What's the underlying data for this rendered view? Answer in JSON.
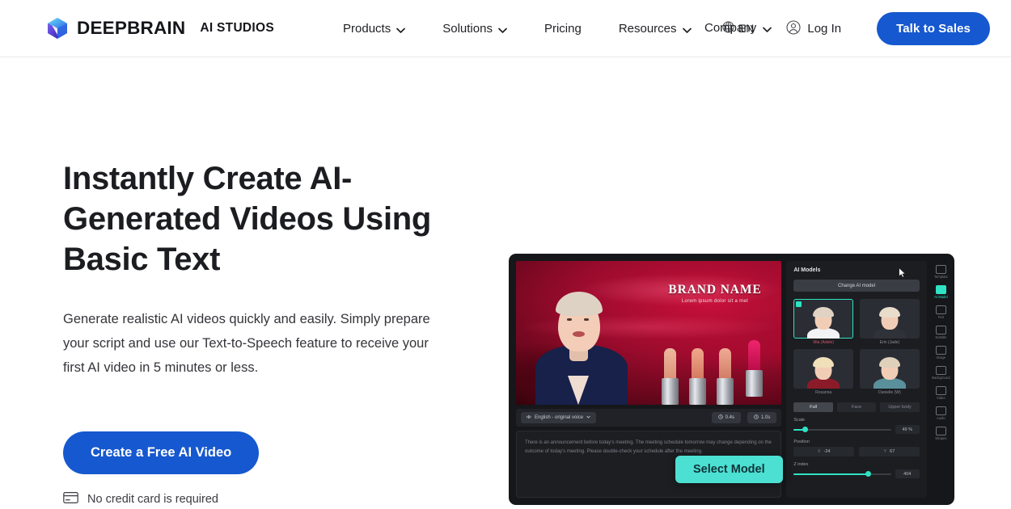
{
  "header": {
    "logo_icon": "deepbrain-cube-logo",
    "brand_name": "DEEPBRAIN",
    "brand_sub": "AI STUDIOS",
    "nav_items": [
      {
        "label": "Products",
        "has_caret": true,
        "icon": "chevron-down-icon"
      },
      {
        "label": "Solutions",
        "has_caret": true,
        "icon": "chevron-down-icon"
      },
      {
        "label": "Pricing",
        "has_caret": false,
        "icon": ""
      },
      {
        "label": "Resources",
        "has_caret": true,
        "icon": "chevron-down-icon"
      },
      {
        "label": "Company",
        "has_caret": true,
        "icon": "chevron-down-icon"
      }
    ],
    "language": {
      "label": "EN",
      "icon": "globe-icon"
    },
    "login": {
      "label": "Log In",
      "icon": "user-circle-icon"
    },
    "cta": {
      "label": "Talk to Sales"
    },
    "accent_blue": "#1658cf"
  },
  "hero": {
    "headline": "Instantly Create AI-Generated Videos Using Basic Text",
    "subcopy": "Generate realistic AI videos quickly and easily. Simply prepare your script and use our Text-to-Speech feature to receive your first AI video in 5 minutes or less.",
    "cta_label": "Create a Free AI Video",
    "note": "No credit card is required",
    "note_icon": "credit-card-icon"
  },
  "mockup": {
    "stage": {
      "brand_title": "BRAND NAME",
      "brand_subtitle": "Lorem ipsum dolor sit a met"
    },
    "voicebar": {
      "voice_chip": "English - original voice",
      "voice_icon": "voice-wave-icon",
      "time_chips": [
        {
          "label": "0.4s",
          "icon": "clock-icon"
        },
        {
          "label": "1.0s",
          "icon": "clock-icon"
        }
      ]
    },
    "script_text": "There is an announcement before today's meeting. The meeting schedule tomorrow may change depending on the outcome of today's meeting. Please double-check your schedule after the meeting.",
    "panel": {
      "title": "AI Models",
      "change_button": "Change AI model",
      "models": [
        {
          "name": "Mia (Adele)",
          "selected": true,
          "hair": "#e0d3c3",
          "shirt": "#f2f3f5"
        },
        {
          "name": "Erin (Jade)",
          "selected": false,
          "hair": "#e8dccb",
          "shirt": "#2f3238"
        },
        {
          "name": "Rosanna",
          "selected": false,
          "hair": "#f0dfb9",
          "shirt": "#8c1b29"
        },
        {
          "name": "Danielle (W)",
          "selected": false,
          "hair": "#dfd0bc",
          "shirt": "#5a8f9c"
        }
      ],
      "segments": [
        {
          "label": "Full",
          "active": true
        },
        {
          "label": "Face",
          "active": false
        },
        {
          "label": "Upper body",
          "active": false
        }
      ],
      "scale": {
        "label": "Scale",
        "value": "49 %",
        "percent": 12
      },
      "position": {
        "label": "Position",
        "x_key": "X",
        "x_value": "-24",
        "y_key": "Y",
        "y_value": "67"
      },
      "zindex": {
        "label": "Z index",
        "value": "404",
        "percent": 78
      },
      "accent_teal": "#2fe3c3"
    },
    "rail": [
      {
        "label": "Template",
        "icon": "template-icon",
        "active": false
      },
      {
        "label": "AI Model",
        "icon": "ai-model-icon",
        "active": true
      },
      {
        "label": "Text",
        "icon": "text-icon",
        "active": false
      },
      {
        "label": "Subtitle",
        "icon": "subtitle-icon",
        "active": false
      },
      {
        "label": "Image",
        "icon": "image-icon",
        "active": false
      },
      {
        "label": "Background",
        "icon": "background-icon",
        "active": false
      },
      {
        "label": "Video",
        "icon": "video-icon",
        "active": false
      },
      {
        "label": "Audio",
        "icon": "audio-icon",
        "active": false
      },
      {
        "label": "Shapes",
        "icon": "shapes-icon",
        "active": false
      }
    ],
    "select_model_button": "Select Model",
    "cursor_icon": "mouse-pointer-icon"
  }
}
